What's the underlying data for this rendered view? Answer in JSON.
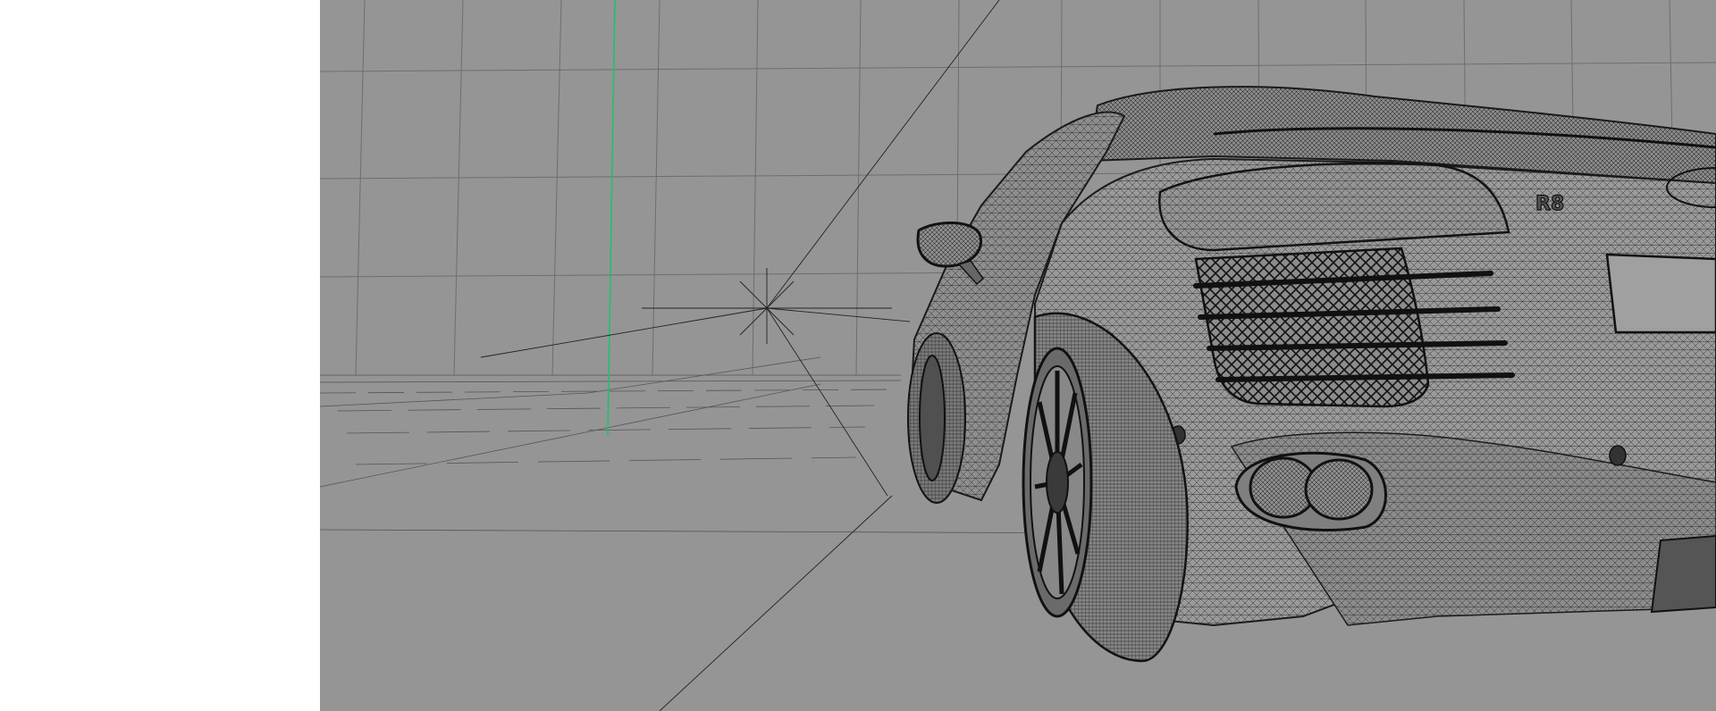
{
  "app": {
    "blank_panel": "empty",
    "viewport": {
      "mode": "wireframe",
      "background_color": "#959595",
      "wire_color": "#1e1e1e",
      "axis_color": "#19c36a"
    },
    "model": {
      "badge_text": "R8"
    }
  }
}
